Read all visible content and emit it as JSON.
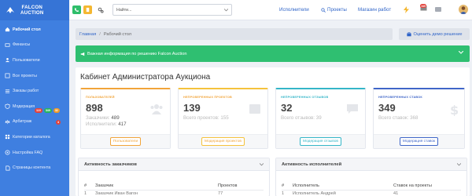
{
  "brand": {
    "name_line1": "FALCON",
    "name_line2": "AUCTION"
  },
  "sidebar": {
    "items": [
      {
        "label": "Рабочий стол",
        "icon": "home-icon"
      },
      {
        "label": "Финансы",
        "icon": "finance-icon"
      },
      {
        "label": "Пользователи",
        "icon": "users-icon"
      },
      {
        "label": "Все проекты",
        "icon": "projects-icon"
      },
      {
        "label": "Заказы работ",
        "icon": "orders-icon"
      },
      {
        "label": "Модерация",
        "icon": "moderation-icon"
      },
      {
        "label": "Арбитраж",
        "icon": "arbitration-icon"
      },
      {
        "label": "Категории каталога",
        "icon": "catalog-icon"
      },
      {
        "label": "Настройка FAQ",
        "icon": "faq-icon"
      },
      {
        "label": "Страницы контента",
        "icon": "pages-icon"
      }
    ],
    "moderation_badges": [
      "119",
      "349",
      "32"
    ],
    "arbitration_badge": "4"
  },
  "topbar": {
    "search_value": "Найти...",
    "links": {
      "executors": "Исполнители",
      "projects": "Проекты",
      "shop": "Магазин работ"
    },
    "mail_badge": "349"
  },
  "breadcrumb": {
    "home": "Главная",
    "current": "Рабочий стол"
  },
  "demo_button": "Оценить демо решение",
  "alert": "Важная информация по решению Falcon Auction",
  "panel_title": "Кабинет Администратора Аукциона",
  "cards": [
    {
      "label": "Пользователей",
      "value": "898",
      "sub1_label": "Заказчики:",
      "sub1_value": "489",
      "sub2_label": "Исполнители:",
      "sub2_value": "417",
      "button": "Пользователи",
      "color": "#f1a43a"
    },
    {
      "label": "Непроверенных проектов",
      "value": "139",
      "sub1_label": "Всего проектов:",
      "sub1_value": "155",
      "button": "Модерация проектов",
      "color": "#f5c23c"
    },
    {
      "label": "Непроверенных отзывов",
      "value": "32",
      "sub1_label": "Всего отзывов:",
      "sub1_value": "39",
      "button": "Модерация отзывов",
      "color": "#35b6c8"
    },
    {
      "label": "Непроверенных ставок",
      "value": "349",
      "sub1_label": "Всего ставок:",
      "sub1_value": "368",
      "button": "Модерация ставок",
      "color": "#3f66c8"
    }
  ],
  "customers_activity": {
    "title": "Активность заказчиков",
    "columns": [
      "#",
      "Заказчик",
      "Проектов"
    ],
    "rows": [
      {
        "num": "1",
        "name": "Заказчик Иван Вагон",
        "count": "77"
      }
    ]
  },
  "executors_activity": {
    "title": "Активность исполнителей",
    "columns": [
      "#",
      "Исполнитель",
      "Ставок на проекты"
    ],
    "rows": [
      {
        "num": "1",
        "name": "Исполнитель Андрей",
        "count": "41"
      }
    ]
  }
}
